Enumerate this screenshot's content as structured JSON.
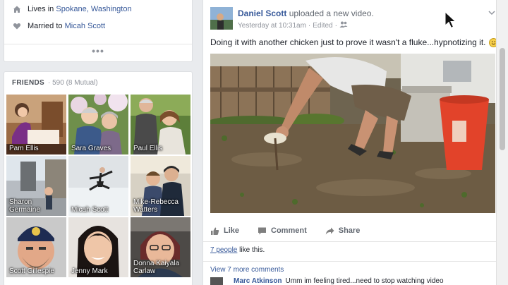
{
  "intro": {
    "lives_prefix": "Lives in",
    "lives_city": "Spokane, Washington",
    "married_prefix": "Married to",
    "married_name": "Micah Scott",
    "more": "•••"
  },
  "friends": {
    "title": "FRIENDS",
    "count": "· 590 (8 Mutual)",
    "tiles": [
      {
        "name": "Pam Ellis"
      },
      {
        "name": "Sara Graves"
      },
      {
        "name": "Paul Ellis"
      },
      {
        "name": "Sharon Germaine"
      },
      {
        "name": "Micah Scott"
      },
      {
        "name": "Mike-Rebecca Watters"
      },
      {
        "name": "Scott Gillespie"
      },
      {
        "name": "Jenny Mark"
      },
      {
        "name": "Donna Kaiyala Carlaw"
      }
    ]
  },
  "post": {
    "author": "Daniel Scott",
    "action": "uploaded a new video.",
    "timestamp": "Yesterday at 10:31am",
    "edited": "Edited",
    "text": "Doing it with another chicken just to prove it wasn't a fluke...hypnotizing it.",
    "actions": {
      "like": "Like",
      "comment": "Comment",
      "share": "Share"
    },
    "likes_link": "7 people",
    "likes_suffix": "like this.",
    "view_more": "View 7 more comments",
    "comment_author": "Marc Atkinson",
    "comment_text": "Umm im feeling tired...need to stop watching video"
  },
  "colors": {
    "link": "#365899",
    "muted": "#90949c",
    "bucket": "#e2432a"
  }
}
